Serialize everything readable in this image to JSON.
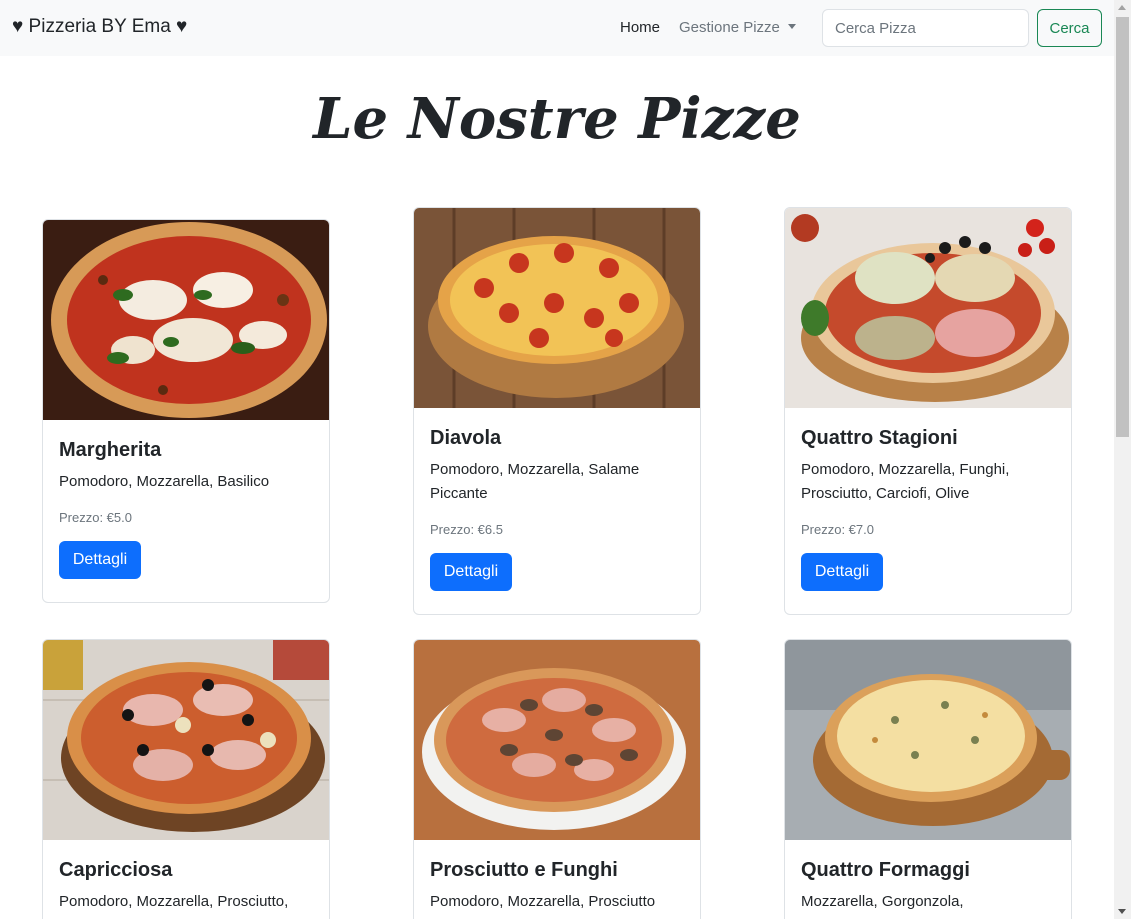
{
  "navbar": {
    "brand": "♥ Pizzeria BY Ema ♥",
    "home": "Home",
    "gestione": "Gestione Pizze",
    "search_placeholder": "Cerca Pizza",
    "search_button": "Cerca"
  },
  "title": "Le Nostre Pizze",
  "pizzas": [
    {
      "name": "Margherita",
      "ingredients": "Pomodoro, Mozzarella, Basilico",
      "price": "Prezzo: €5.0",
      "button": "Dettagli"
    },
    {
      "name": "Diavola",
      "ingredients": "Pomodoro, Mozzarella, Salame Piccante",
      "price": "Prezzo: €6.5",
      "button": "Dettagli"
    },
    {
      "name": "Quattro Stagioni",
      "ingredients": "Pomodoro, Mozzarella, Funghi, Prosciutto, Carciofi, Olive",
      "price": "Prezzo: €7.0",
      "button": "Dettagli"
    },
    {
      "name": "Capricciosa",
      "ingredients": "Pomodoro, Mozzarella, Prosciutto,",
      "price": "",
      "button": ""
    },
    {
      "name": "Prosciutto e Funghi",
      "ingredients": "Pomodoro, Mozzarella, Prosciutto",
      "price": "",
      "button": ""
    },
    {
      "name": "Quattro Formaggi",
      "ingredients": "Mozzarella, Gorgonzola,",
      "price": "",
      "button": ""
    }
  ],
  "colors": {
    "primary": "#0d6efd",
    "success": "#198754",
    "navbar_bg": "#f8f9fa"
  }
}
